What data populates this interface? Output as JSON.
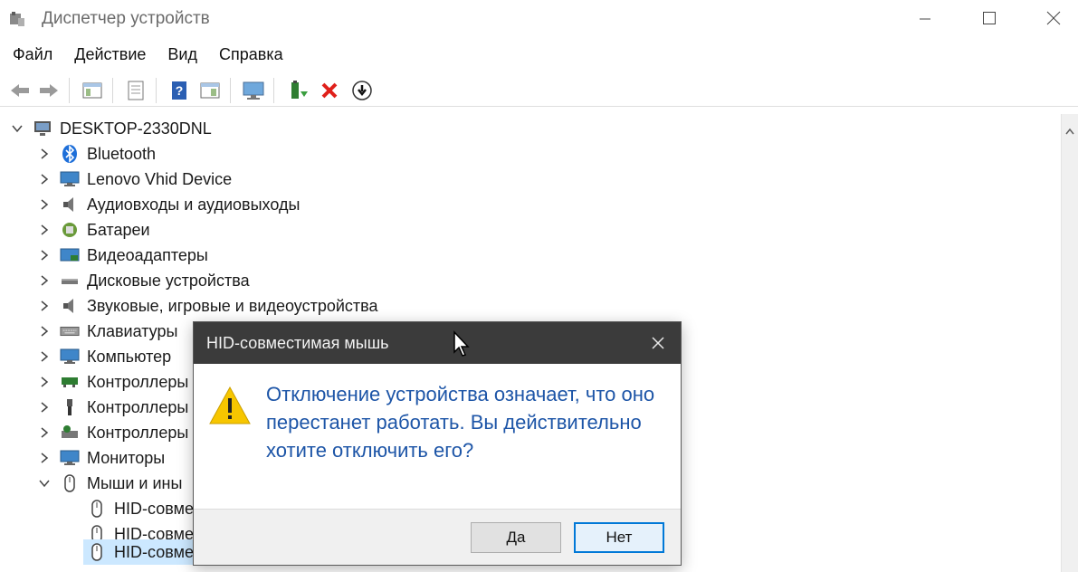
{
  "window": {
    "title": "Диспетчер устройств"
  },
  "menu": [
    "Файл",
    "Действие",
    "Вид",
    "Справка"
  ],
  "toolbar_icons": [
    "back-icon",
    "forward-icon",
    "show-hide-tree-icon",
    "properties-icon",
    "help-icon",
    "view-icon",
    "monitor-icon",
    "update-driver-icon",
    "uninstall-icon",
    "disable-icon"
  ],
  "tree": {
    "root": "DESKTOP-2330DNL",
    "items": [
      {
        "label": "Bluetooth",
        "icon": "bluetooth-icon"
      },
      {
        "label": "Lenovo Vhid Device",
        "icon": "monitor-icon"
      },
      {
        "label": "Аудиовходы и аудиовыходы",
        "icon": "speaker-icon"
      },
      {
        "label": "Батареи",
        "icon": "battery-icon"
      },
      {
        "label": "Видеоадаптеры",
        "icon": "display-adapter-icon"
      },
      {
        "label": "Дисковые устройства",
        "icon": "disk-icon"
      },
      {
        "label": "Звуковые, игровые и видеоустройства",
        "icon": "speaker-icon"
      },
      {
        "label": "Клавиатуры",
        "icon": "keyboard-icon"
      },
      {
        "label": "Компьютер",
        "icon": "computer-icon"
      },
      {
        "label": "Контроллеры",
        "icon": "controller-icon"
      },
      {
        "label": "Контроллеры",
        "icon": "usb-icon"
      },
      {
        "label": "Контроллеры",
        "icon": "storage-controller-icon"
      },
      {
        "label": "Мониторы",
        "icon": "monitor-icon"
      },
      {
        "label": "Мыши и ины",
        "icon": "mouse-icon"
      }
    ],
    "children": [
      {
        "label": "HID-совме",
        "icon": "mouse-icon"
      },
      {
        "label": "HID-совме",
        "icon": "mouse-icon"
      },
      {
        "label": "HID-совме",
        "icon": "mouse-icon"
      }
    ]
  },
  "dialog": {
    "title": "HID-совместимая мышь",
    "message": "Отключение устройства означает, что оно перестанет работать. Вы действительно хотите отключить его?",
    "yes": "Да",
    "no": "Нет"
  },
  "colors": {
    "dialog_title_bg": "#3b3b3b",
    "message_text": "#1d55a7",
    "selection": "#cce8ff",
    "accent": "#0078d7"
  }
}
